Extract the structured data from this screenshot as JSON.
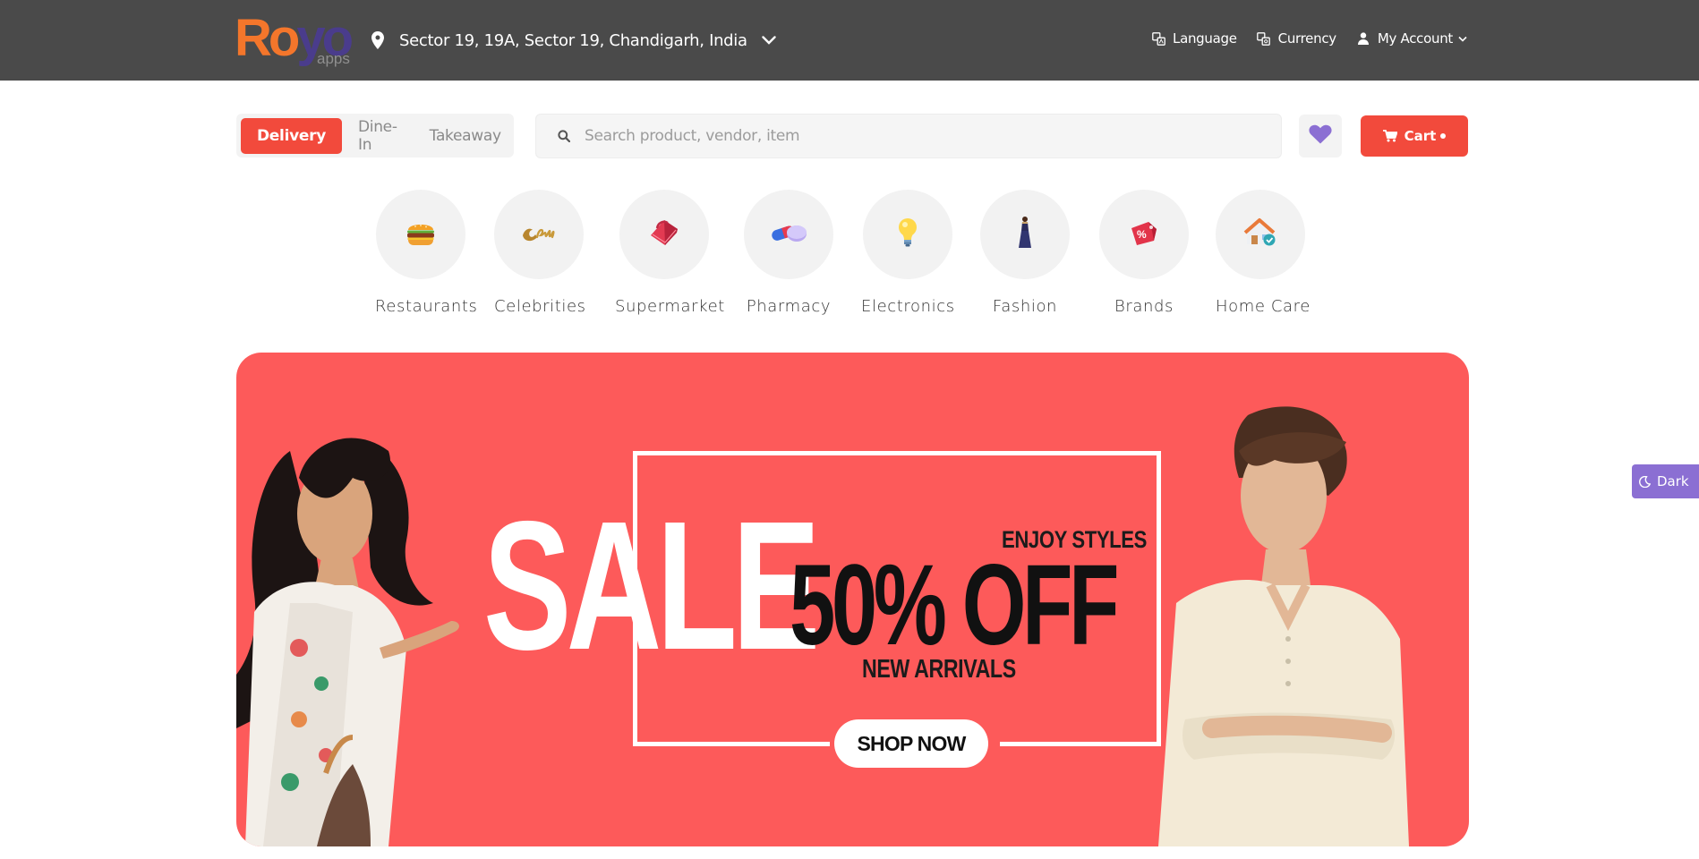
{
  "brand": {
    "logo_text": "Royo",
    "logo_sub": "apps",
    "colors": {
      "primary": "#f24a3c",
      "logo_orange": "#f4762b",
      "logo_purple": "#4a3c8c",
      "header_bg": "#4a4a4a",
      "banner_bg": "#fd5a5a",
      "accent_purple": "#8b6fd3"
    }
  },
  "header": {
    "location": {
      "icon": "map-pin-icon",
      "address": "Sector 19, 19A, Sector 19, Chandigarh, India"
    },
    "links": {
      "language": {
        "icon": "language-icon",
        "label": "Language"
      },
      "currency": {
        "icon": "currency-icon",
        "label": "Currency"
      },
      "account": {
        "icon": "user-icon",
        "label": "My Account"
      }
    }
  },
  "order_modes": {
    "options": [
      "Delivery",
      "Dine-In",
      "Takeaway"
    ],
    "selected": "Delivery"
  },
  "search": {
    "placeholder": "Search product, vendor, item",
    "value": ""
  },
  "wishlist": {
    "icon": "heart-icon"
  },
  "cart": {
    "icon": "cart-icon",
    "label": "Cart"
  },
  "categories": [
    {
      "label": "Restaurants",
      "icon": "burger-icon"
    },
    {
      "label": "Celebrities",
      "icon": "celebrity-icon"
    },
    {
      "label": "Supermarket",
      "icon": "basket-icon"
    },
    {
      "label": "Pharmacy",
      "icon": "pills-icon"
    },
    {
      "label": "Electronics",
      "icon": "bulb-icon"
    },
    {
      "label": "Fashion",
      "icon": "dress-icon"
    },
    {
      "label": "Brands",
      "icon": "tag-icon"
    },
    {
      "label": "Home Care",
      "icon": "house-icon"
    }
  ],
  "banner": {
    "headline": "SALE",
    "tagline_top": "ENJOY STYLES",
    "discount": "50% OFF",
    "tagline_bottom": "NEW ARRIVALS",
    "cta": "SHOP NOW"
  },
  "theme_toggle": {
    "icon": "moon-icon",
    "label": "Dark"
  }
}
